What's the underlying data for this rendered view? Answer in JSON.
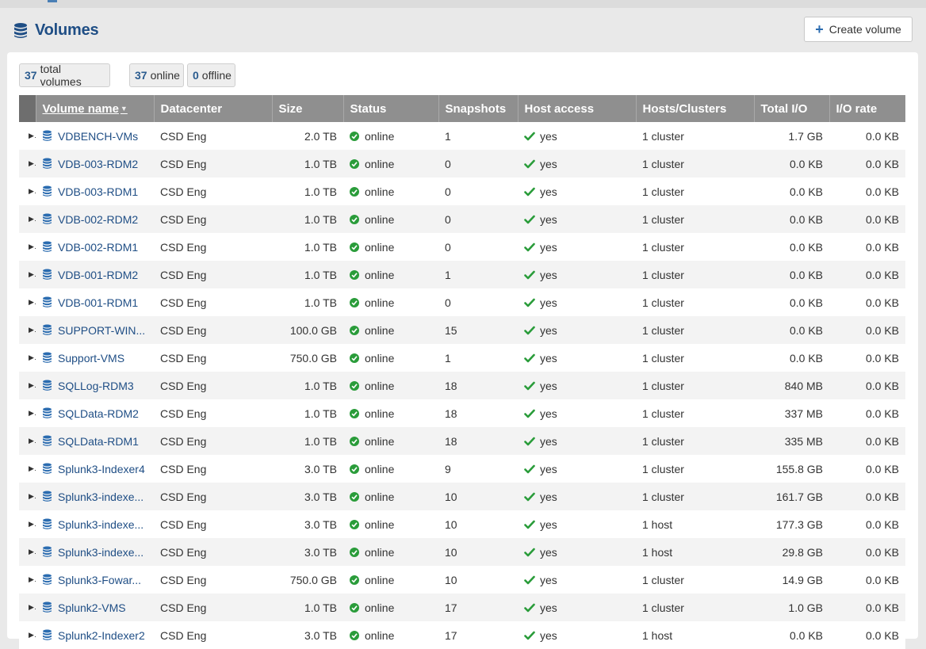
{
  "page": {
    "title": "Volumes",
    "create_label": "Create volume"
  },
  "summary": {
    "total_count": "37",
    "total_label": "total volumes",
    "online_count": "37",
    "online_label": "online",
    "offline_count": "0",
    "offline_label": "offline"
  },
  "table": {
    "columns": [
      "Volume name",
      "Datacenter",
      "Size",
      "Status",
      "Snapshots",
      "Host access",
      "Hosts/Clusters",
      "Total I/O",
      "I/O rate"
    ],
    "rows": [
      {
        "name": "VDBENCH-VMs",
        "datacenter": "CSD Eng",
        "size": "2.0 TB",
        "status": "online",
        "snapshots": "1",
        "host_access": "yes",
        "hosts": "1 cluster",
        "total_io": "1.7 GB",
        "io_rate": "0.0 KB"
      },
      {
        "name": "VDB-003-RDM2",
        "datacenter": "CSD Eng",
        "size": "1.0 TB",
        "status": "online",
        "snapshots": "0",
        "host_access": "yes",
        "hosts": "1 cluster",
        "total_io": "0.0 KB",
        "io_rate": "0.0 KB"
      },
      {
        "name": "VDB-003-RDM1",
        "datacenter": "CSD Eng",
        "size": "1.0 TB",
        "status": "online",
        "snapshots": "0",
        "host_access": "yes",
        "hosts": "1 cluster",
        "total_io": "0.0 KB",
        "io_rate": "0.0 KB"
      },
      {
        "name": "VDB-002-RDM2",
        "datacenter": "CSD Eng",
        "size": "1.0 TB",
        "status": "online",
        "snapshots": "0",
        "host_access": "yes",
        "hosts": "1 cluster",
        "total_io": "0.0 KB",
        "io_rate": "0.0 KB"
      },
      {
        "name": "VDB-002-RDM1",
        "datacenter": "CSD Eng",
        "size": "1.0 TB",
        "status": "online",
        "snapshots": "0",
        "host_access": "yes",
        "hosts": "1 cluster",
        "total_io": "0.0 KB",
        "io_rate": "0.0 KB"
      },
      {
        "name": "VDB-001-RDM2",
        "datacenter": "CSD Eng",
        "size": "1.0 TB",
        "status": "online",
        "snapshots": "1",
        "host_access": "yes",
        "hosts": "1 cluster",
        "total_io": "0.0 KB",
        "io_rate": "0.0 KB"
      },
      {
        "name": "VDB-001-RDM1",
        "datacenter": "CSD Eng",
        "size": "1.0 TB",
        "status": "online",
        "snapshots": "0",
        "host_access": "yes",
        "hosts": "1 cluster",
        "total_io": "0.0 KB",
        "io_rate": "0.0 KB"
      },
      {
        "name": "SUPPORT-WIN...",
        "datacenter": "CSD Eng",
        "size": "100.0 GB",
        "status": "online",
        "snapshots": "15",
        "host_access": "yes",
        "hosts": "1 cluster",
        "total_io": "0.0 KB",
        "io_rate": "0.0 KB"
      },
      {
        "name": "Support-VMS",
        "datacenter": "CSD Eng",
        "size": "750.0 GB",
        "status": "online",
        "snapshots": "1",
        "host_access": "yes",
        "hosts": "1 cluster",
        "total_io": "0.0 KB",
        "io_rate": "0.0 KB"
      },
      {
        "name": "SQLLog-RDM3",
        "datacenter": "CSD Eng",
        "size": "1.0 TB",
        "status": "online",
        "snapshots": "18",
        "host_access": "yes",
        "hosts": "1 cluster",
        "total_io": "840 MB",
        "io_rate": "0.0 KB"
      },
      {
        "name": "SQLData-RDM2",
        "datacenter": "CSD Eng",
        "size": "1.0 TB",
        "status": "online",
        "snapshots": "18",
        "host_access": "yes",
        "hosts": "1 cluster",
        "total_io": "337 MB",
        "io_rate": "0.0 KB"
      },
      {
        "name": "SQLData-RDM1",
        "datacenter": "CSD Eng",
        "size": "1.0 TB",
        "status": "online",
        "snapshots": "18",
        "host_access": "yes",
        "hosts": "1 cluster",
        "total_io": "335 MB",
        "io_rate": "0.0 KB"
      },
      {
        "name": "Splunk3-Indexer4",
        "datacenter": "CSD Eng",
        "size": "3.0 TB",
        "status": "online",
        "snapshots": "9",
        "host_access": "yes",
        "hosts": "1 cluster",
        "total_io": "155.8 GB",
        "io_rate": "0.0 KB"
      },
      {
        "name": "Splunk3-indexe...",
        "datacenter": "CSD Eng",
        "size": "3.0 TB",
        "status": "online",
        "snapshots": "10",
        "host_access": "yes",
        "hosts": "1 cluster",
        "total_io": "161.7 GB",
        "io_rate": "0.0 KB"
      },
      {
        "name": "Splunk3-indexe...",
        "datacenter": "CSD Eng",
        "size": "3.0 TB",
        "status": "online",
        "snapshots": "10",
        "host_access": "yes",
        "hosts": "1 host",
        "total_io": "177.3 GB",
        "io_rate": "0.0 KB"
      },
      {
        "name": "Splunk3-indexe...",
        "datacenter": "CSD Eng",
        "size": "3.0 TB",
        "status": "online",
        "snapshots": "10",
        "host_access": "yes",
        "hosts": "1 host",
        "total_io": "29.8 GB",
        "io_rate": "0.0 KB"
      },
      {
        "name": "Splunk3-Fowar...",
        "datacenter": "CSD Eng",
        "size": "750.0 GB",
        "status": "online",
        "snapshots": "10",
        "host_access": "yes",
        "hosts": "1 cluster",
        "total_io": "14.9 GB",
        "io_rate": "0.0 KB"
      },
      {
        "name": "Splunk2-VMS",
        "datacenter": "CSD Eng",
        "size": "1.0 TB",
        "status": "online",
        "snapshots": "17",
        "host_access": "yes",
        "hosts": "1 cluster",
        "total_io": "1.0 GB",
        "io_rate": "0.0 KB"
      },
      {
        "name": "Splunk2-Indexer2",
        "datacenter": "CSD Eng",
        "size": "3.0 TB",
        "status": "online",
        "snapshots": "17",
        "host_access": "yes",
        "hosts": "1 host",
        "total_io": "0.0 KB",
        "io_rate": "0.0 KB"
      }
    ]
  },
  "colors": {
    "brand": "#1f4e85",
    "status_online": "#2a9c3a",
    "header_bg": "#8f8f8f"
  },
  "icons": {
    "title": "database-icon",
    "create": "plus-icon",
    "row": "database-icon",
    "status": "online-status-icon",
    "host": "check-icon",
    "expander": "caret-right-icon",
    "sort": "sort-caret-icon"
  }
}
